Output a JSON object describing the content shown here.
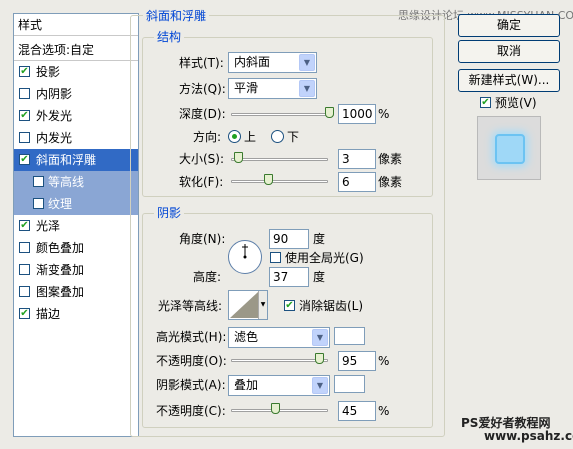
{
  "watermark_top": "思缘设计论坛 www.MISSYUAN.COM",
  "watermark_bottom_1": "PS爱好者教程网",
  "watermark_bottom_2": "www.psahz.com",
  "styles_panel": {
    "header": "样式",
    "blend_options": "混合选项:自定",
    "items": [
      {
        "label": "投影",
        "checked": true
      },
      {
        "label": "内阴影",
        "checked": false
      },
      {
        "label": "外发光",
        "checked": true
      },
      {
        "label": "内发光",
        "checked": false
      },
      {
        "label": "斜面和浮雕",
        "checked": true,
        "selected": true
      },
      {
        "label": "等高线",
        "checked": false,
        "sub": true
      },
      {
        "label": "纹理",
        "checked": false,
        "sub": true
      },
      {
        "label": "光泽",
        "checked": true
      },
      {
        "label": "颜色叠加",
        "checked": false
      },
      {
        "label": "渐变叠加",
        "checked": false
      },
      {
        "label": "图案叠加",
        "checked": false
      },
      {
        "label": "描边",
        "checked": true
      }
    ]
  },
  "bevel": {
    "group_title": "斜面和浮雕",
    "structure_title": "结构",
    "style_label": "样式(T):",
    "style_value": "内斜面",
    "technique_label": "方法(Q):",
    "technique_value": "平滑",
    "depth_label": "深度(D):",
    "depth_value": "1000",
    "depth_unit": "%",
    "depth_level": 1.0,
    "direction_label": "方向:",
    "direction_up": "上",
    "direction_down": "下",
    "size_label": "大小(S):",
    "size_value": "3",
    "size_unit": "像素",
    "size_level": 0.03,
    "soften_label": "软化(F):",
    "soften_value": "6",
    "soften_unit": "像素",
    "soften_level": 0.38
  },
  "shading": {
    "title": "阴影",
    "angle_label": "角度(N):",
    "angle_value": "90",
    "angle_unit": "度",
    "global_light_label": "使用全局光(G)",
    "altitude_label": "高度:",
    "altitude_value": "37",
    "altitude_unit": "度",
    "gloss_label": "光泽等高线:",
    "antialias_label": "消除锯齿(L)",
    "highlight_label": "高光模式(H):",
    "highlight_value": "滤色",
    "highlight_opacity_label": "不透明度(O):",
    "highlight_opacity_value": "95",
    "highlight_opacity_unit": "%",
    "highlight_opacity_level": 0.95,
    "shadow_label": "阴影模式(A):",
    "shadow_value": "叠加",
    "shadow_opacity_label": "不透明度(C):",
    "shadow_opacity_value": "45",
    "shadow_opacity_unit": "%",
    "shadow_opacity_level": 0.45
  },
  "buttons": {
    "ok": "确定",
    "cancel": "取消",
    "new_style": "新建样式(W)...",
    "preview_label": "预览(V)"
  },
  "colors": {
    "accent": "#316ac5",
    "group_title": "#0046d5"
  }
}
